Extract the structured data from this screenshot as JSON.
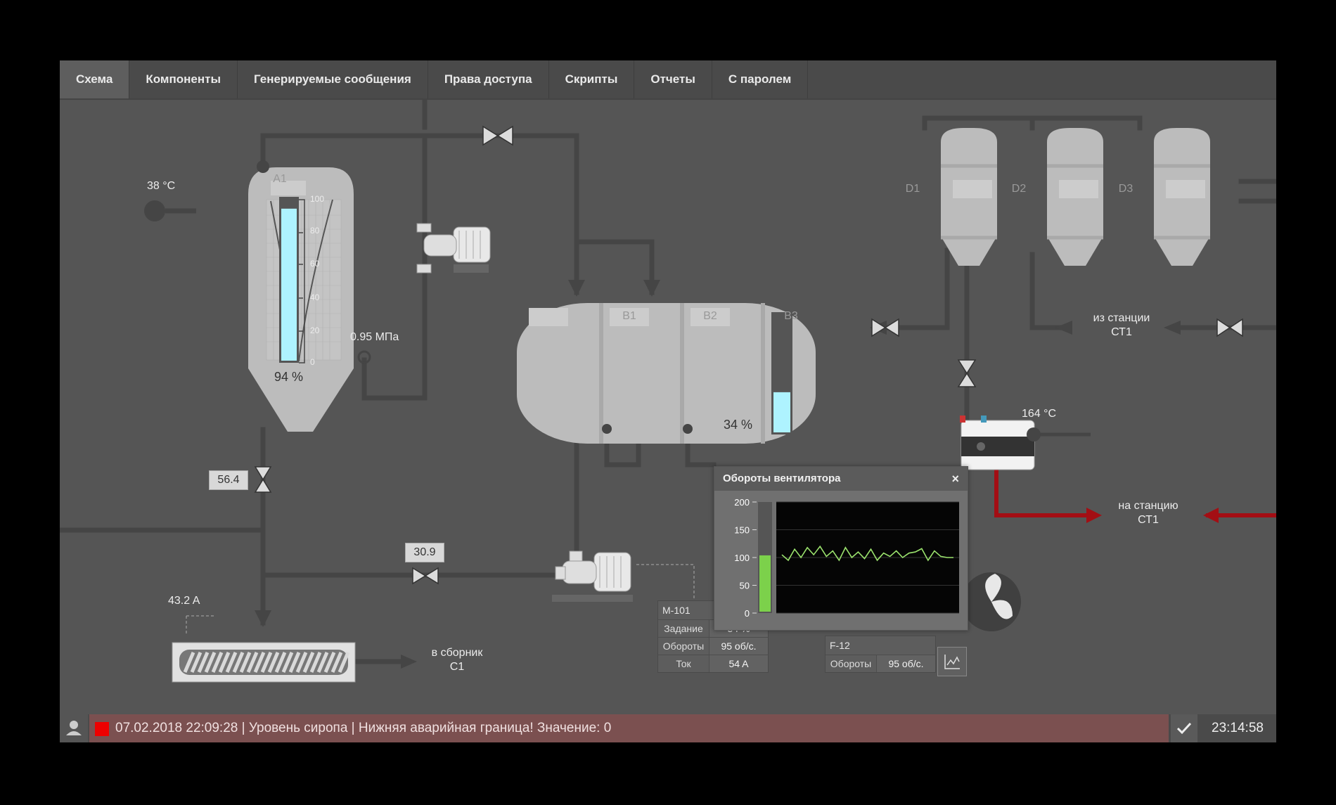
{
  "nav": {
    "tabs": [
      {
        "label": "Схема",
        "active": true
      },
      {
        "label": "Компоненты"
      },
      {
        "label": "Генерируемые сообщения"
      },
      {
        "label": "Права доступа"
      },
      {
        "label": "Скрипты"
      },
      {
        "label": "Отчеты"
      },
      {
        "label": "С паролем"
      }
    ]
  },
  "silo": {
    "name": "A1",
    "temperature": "38 °C",
    "level_text": "94 %",
    "level_fraction": 0.94,
    "scale_ticks": [
      "100",
      "80",
      "60",
      "40",
      "20",
      "0"
    ],
    "pressure": "0.95 МПа",
    "valve_value": "56.4"
  },
  "tank": {
    "sections": [
      "B1",
      "B2",
      "B3"
    ],
    "level_text": "34 %",
    "level_fraction": 0.34
  },
  "line": {
    "valve_value": "30.9"
  },
  "screw": {
    "current": "43.2 A",
    "dest": [
      "в сборник",
      "С1"
    ]
  },
  "vessels": [
    "D1",
    "D2",
    "D3"
  ],
  "from_station": [
    "из станции",
    "СТ1"
  ],
  "to_station": [
    "на станцию",
    "СТ1"
  ],
  "heater": {
    "temperature": "164 °C"
  },
  "popup": {
    "title": "Обороты вентилятора",
    "close": "×",
    "y_ticks": [
      "200",
      "150",
      "100",
      "50",
      "0"
    ],
    "bar_fraction": 0.52
  },
  "chart_data": {
    "type": "line",
    "title": "Обороты вентилятора",
    "ylim": [
      0,
      200
    ],
    "series": [
      {
        "values": [
          105,
          95,
          115,
          100,
          118,
          105,
          120,
          102,
          112,
          95,
          118,
          100,
          110,
          98,
          115,
          95,
          108,
          102,
          112,
          100,
          108,
          110,
          116,
          95,
          112,
          102,
          100,
          100
        ]
      }
    ]
  },
  "m101": {
    "name": "M-101",
    "rows": [
      {
        "k": "Задание",
        "v": "54 %"
      },
      {
        "k": "Обороты",
        "v": "95 об/с."
      },
      {
        "k": "Ток",
        "v": "54 A"
      }
    ]
  },
  "f12": {
    "name": "F-12",
    "rows": [
      {
        "k": "Обороты",
        "v": "95 об/с."
      }
    ]
  },
  "status": {
    "message": "07.02.2018 22:09:28 | Уровень сиропа | Нижняя аварийная граница! Значение: 0",
    "clock": "23:14:58"
  },
  "colors": {
    "pipe": "#454545",
    "hot_pipe": "#a30e14",
    "liquid": "#aef3ff",
    "vessel": "#bcbcbc",
    "alarm": "#e00000",
    "trend_line": "#9be36d",
    "trend_bar": "#7cd14b"
  }
}
